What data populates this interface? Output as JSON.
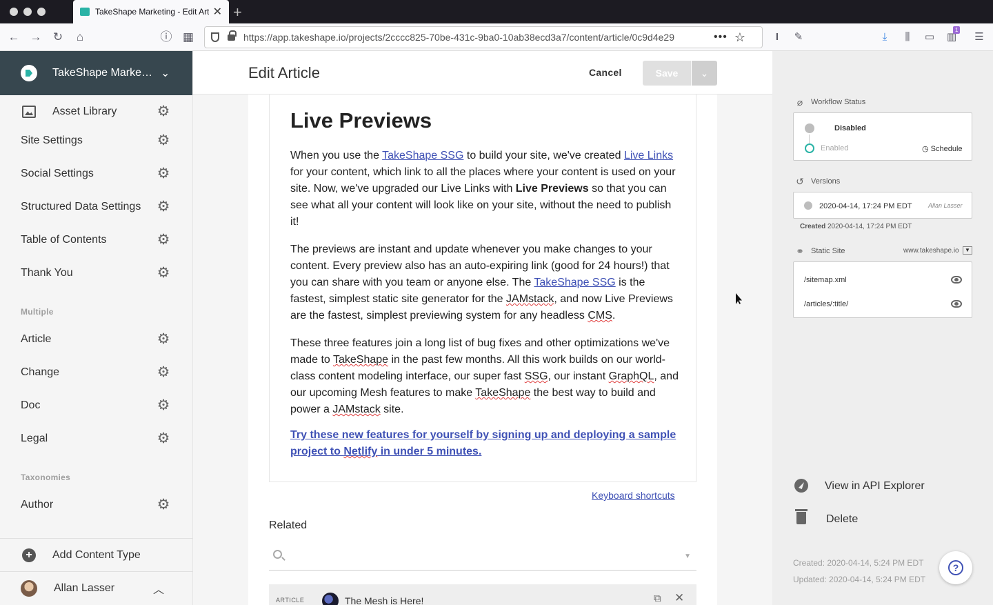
{
  "browser": {
    "tab_title": "TakeShape Marketing - Edit Arti",
    "tab_close": "✕",
    "new_tab": "+",
    "url": "https://app.takeshape.io/projects/2cccc825-70be-431c-9ba0-10ab38ecd3a7/content/article/0c9d4e29",
    "more": "•••",
    "badge": "1"
  },
  "sidebar": {
    "project_name": "TakeShape Marketing",
    "asset_library": "Asset Library",
    "singles": [
      "Site Settings",
      "Social Settings",
      "Structured Data Settings",
      "Table of Contents",
      "Thank You"
    ],
    "multiple_header": "Multiple",
    "multiple": [
      "Article",
      "Change",
      "Doc",
      "Legal"
    ],
    "taxonomies_header": "Taxonomies",
    "taxonomies": [
      "Author"
    ],
    "add_content_type": "Add Content Type",
    "user_name": "Allan Lasser"
  },
  "editor": {
    "title": "Edit Article",
    "cancel_label": "Cancel",
    "save_label": "Save",
    "heading": "Live Previews",
    "p1": {
      "t1": "When you use the ",
      "link1": "TakeShape SSG",
      "t2": " to build your site, we've created ",
      "link2": "Live Links",
      "t3": " for your content, which link to all the places where your content is used on your site. Now, we've upgraded our Live Links with ",
      "bold": "Live Previews",
      "t4": " so that you can see what all your content will look like on your site, without the need to publish it!"
    },
    "p2": {
      "t1": "The previews are instant and update whenever you make changes to your content. Every preview also has an auto-expiring link (good for 24 hours!) that you can share with you team or anyone else. The ",
      "link1": "TakeShape SSG",
      "t2": " is the fastest, simplest static site generator for the ",
      "w1": "JAMstack",
      "t3": ", and now Live Previews are the fastest, simplest previewing system for any headless ",
      "w2": "CMS",
      "t4": "."
    },
    "p3": {
      "t1": "These three features join a long list of bug fixes and other optimizations we've made to ",
      "w1": "TakeShape",
      "t2": " in the past few months. All this work builds on our world-class content modeling interface, our super fast ",
      "w2": "SSG",
      "t3": ", our instant ",
      "w3": "GraphQL",
      "t4": ", and our upcoming Mesh features to make ",
      "w4": "TakeShape",
      "t5": " the best way to build and power a ",
      "w5": "JAMstack",
      "t6": " site."
    },
    "cta": {
      "t1": "Try these new features for yourself by signing up and deploying a sample project to ",
      "w1": "Netlify",
      "t2": " in under 5 minutes."
    },
    "keyboard_shortcuts": "Keyboard shortcuts",
    "related_label": "Related",
    "related_item": {
      "type": "ARTICLE",
      "title": "The Mesh is Here!"
    }
  },
  "rpanel": {
    "workflow_label": "Workflow Status",
    "status_disabled": "Disabled",
    "status_enabled": "Enabled",
    "schedule": "Schedule",
    "versions_label": "Versions",
    "version_date": "2020-04-14, 17:24 PM EDT",
    "version_author": "Allan Lasser",
    "created_label": "Created",
    "created_value": "2020-04-14, 17:24 PM EDT",
    "static_site_label": "Static Site",
    "static_site_domain": "www.takeshape.io",
    "routes": [
      "/sitemap.xml",
      "/articles/:title/"
    ],
    "api_explorer": "View in API Explorer",
    "delete": "Delete",
    "created_meta": "Created: 2020-04-14, 5:24 PM EDT",
    "updated_meta": "Updated: 2020-04-14, 5:24 PM EDT",
    "help": "?"
  },
  "colors": {
    "accent": "#2ab3a6",
    "link": "#3f51b5",
    "header_bg": "#37474f"
  },
  "icons": {
    "gear": "gear-icon",
    "search": "search-icon",
    "eye": "eye-icon",
    "compass": "compass-icon",
    "trash": "trash-icon"
  }
}
